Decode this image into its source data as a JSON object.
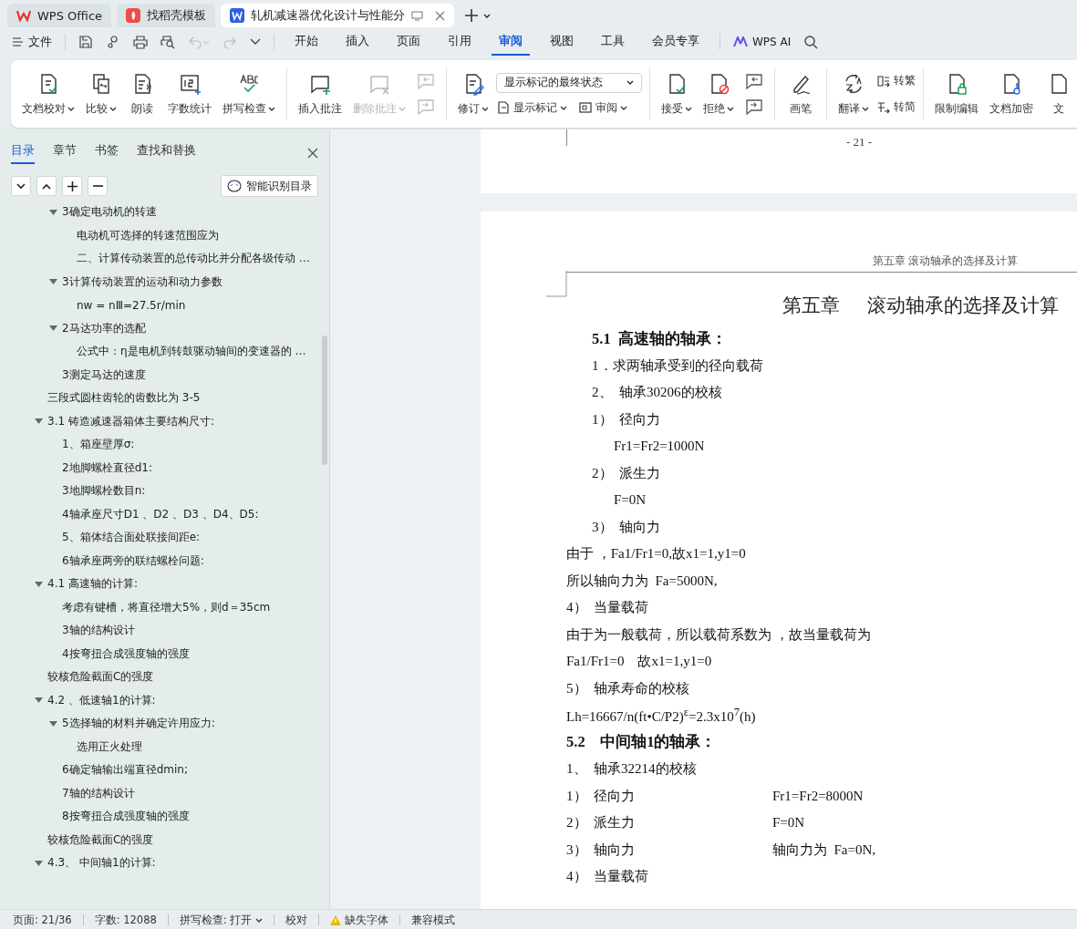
{
  "tabs": [
    {
      "label": "WPS Office",
      "kind": "home",
      "selected": false
    },
    {
      "label": "找稻壳模板",
      "kind": "template",
      "selected": false
    },
    {
      "label": "轧机减速器优化设计与性能分",
      "kind": "document",
      "selected": true
    }
  ],
  "file_menu": "文件",
  "history": {
    "undo_enabled": false,
    "redo_enabled": false
  },
  "menu_tabs": [
    {
      "label": "开始",
      "selected": false
    },
    {
      "label": "插入",
      "selected": false
    },
    {
      "label": "页面",
      "selected": false
    },
    {
      "label": "引用",
      "selected": false
    },
    {
      "label": "审阅",
      "selected": true
    },
    {
      "label": "视图",
      "selected": false
    },
    {
      "label": "工具",
      "selected": false
    },
    {
      "label": "会员专享",
      "selected": false
    }
  ],
  "ai_button": "WPS AI",
  "ribbon": {
    "groups": [
      {
        "items": [
          {
            "kind": "large",
            "label": "文档校对",
            "caret": true,
            "disabled": false
          },
          {
            "kind": "large",
            "label": "比较",
            "caret": true,
            "disabled": false
          },
          {
            "kind": "large",
            "label": "朗读",
            "caret": false,
            "disabled": false
          },
          {
            "kind": "large",
            "label": "字数统计",
            "caret": false,
            "disabled": false
          },
          {
            "kind": "large",
            "label": "拼写检查",
            "caret": true,
            "disabled": false
          }
        ]
      },
      {
        "items": [
          {
            "kind": "large",
            "label": "插入批注",
            "caret": false,
            "disabled": false
          },
          {
            "kind": "large",
            "label": "删除批注",
            "caret": true,
            "disabled": true
          },
          {
            "kind": "icon_stack",
            "disabled": true
          }
        ]
      },
      {
        "items": [
          {
            "kind": "large",
            "label": "修订",
            "caret": true,
            "disabled": false
          },
          {
            "kind": "select_panel",
            "value": "显示标记的最终状态",
            "buttons": [
              {
                "label": "显示标记",
                "caret": true
              },
              {
                "label": "审阅",
                "caret": true
              }
            ]
          }
        ]
      },
      {
        "items": [
          {
            "kind": "large",
            "label": "接受",
            "caret": true,
            "disabled": false
          },
          {
            "kind": "large",
            "label": "拒绝",
            "caret": true,
            "disabled": false
          },
          {
            "kind": "icon_stack",
            "disabled": false
          }
        ]
      },
      {
        "items": [
          {
            "kind": "large",
            "label": "画笔",
            "caret": false,
            "disabled": false
          }
        ]
      },
      {
        "items": [
          {
            "kind": "large",
            "label": "翻译",
            "caret": true,
            "disabled": false
          },
          {
            "kind": "small_stack",
            "buttons": [
              {
                "label": "转繁",
                "caret": false
              },
              {
                "label": "转简",
                "caret": false
              }
            ]
          }
        ]
      },
      {
        "items": [
          {
            "kind": "large",
            "label": "限制编辑",
            "caret": false,
            "disabled": false
          },
          {
            "kind": "large",
            "label": "文档加密",
            "caret": false,
            "disabled": false
          },
          {
            "kind": "large",
            "label": "文",
            "caret": false,
            "disabled": false
          }
        ]
      }
    ]
  },
  "nav": {
    "tabs": [
      {
        "label": "目录",
        "selected": true
      },
      {
        "label": "章节",
        "selected": false
      },
      {
        "label": "书签",
        "selected": false
      },
      {
        "label": "查找和替换",
        "selected": false
      }
    ],
    "smart_toc_button": "智能识别目录",
    "toc": {
      "continued": [
        {
          "label": "3确定电动机的转速",
          "expanded": true,
          "children": [
            {
              "label": "电动机可选择的转速范围应为"
            },
            {
              "label": "二、计算传动装置的总传动比并分配各级传动 …"
            }
          ]
        },
        {
          "label": "3计算传动装置的运动和动力参数",
          "expanded": true,
          "children": [
            {
              "label": "nw = nⅢ=27.5r/min"
            }
          ]
        },
        {
          "label": "2马达功率的选配",
          "expanded": true,
          "children": [
            {
              "label": "公式中：η是电机到转鼓驱动轴间的变速器的 …"
            }
          ]
        },
        {
          "label": "3测定马达的速度"
        }
      ],
      "items": [
        {
          "label": "三段式圆柱齿轮的齿数比为 3-5"
        },
        {
          "label": "3.1  铸造减速器箱体主要结构尺寸:",
          "expanded": true,
          "children": [
            {
              "label": "1、箱座壁厚σ:"
            },
            {
              "label": "2地脚螺栓直径d1:"
            },
            {
              "label": "3地脚螺栓数目n:"
            },
            {
              "label": "4轴承座尺寸D1 、D2 、D3 、D4、D5:"
            },
            {
              "label": "5、箱体结合面处联接间距e:"
            },
            {
              "label": "6轴承座两旁的联结螺栓问题:"
            }
          ]
        },
        {
          "label": "4.1  高速轴的计算:",
          "expanded": true,
          "children": [
            {
              "label": "考虑有键槽，将直径增大5%，则d＝35cm"
            },
            {
              "label": "3轴的结构设计"
            },
            {
              "label": "4按弯扭合成强度轴的强度"
            }
          ]
        },
        {
          "label": "较核危险截面C的强度"
        },
        {
          "label": "4.2 、低速轴1的计算:",
          "expanded": true,
          "children": [
            {
              "label": "5选择轴的材料并确定许用应力:",
              "expanded": true,
              "children": [
                {
                  "label": "选用正火处理"
                }
              ]
            },
            {
              "label": "6确定轴输出端直径dmin;"
            },
            {
              "label": "7轴的结构设计"
            },
            {
              "label": "8按弯扭合成强度轴的强度"
            }
          ]
        },
        {
          "label": "较核危险截面C的强度"
        },
        {
          "label": "4.3、 中间轴1的计算:",
          "expanded": true
        }
      ]
    }
  },
  "document": {
    "previous_page_number": "- 21 -",
    "page": {
      "running_header": "第五章  滚动轴承的选择及计算",
      "chapter_number": "第五章",
      "chapter_title": "滚动轴承的选择及计算",
      "paragraphs": [
        {
          "kind": "heading_indented",
          "text": "5.1  高速轴的轴承："
        },
        {
          "kind": "item",
          "text": "1．求两轴承受到的径向载荷"
        },
        {
          "kind": "item",
          "text": "2、  轴承30206的校核"
        },
        {
          "kind": "item",
          "text": "1）  径向力"
        },
        {
          "kind": "detail",
          "text": "Fr1=Fr2=1000N"
        },
        {
          "kind": "item",
          "text": "2）  派生力"
        },
        {
          "kind": "detail",
          "text": "F=0N"
        },
        {
          "kind": "item",
          "text": "3）  轴向力"
        },
        {
          "kind": "body",
          "text": "由于 ，Fa1/Fr1=0,故x1=1,y1=0"
        },
        {
          "kind": "body",
          "text": "所以轴向力为  Fa=5000N,"
        },
        {
          "kind": "body",
          "text": "4）  当量载荷"
        },
        {
          "kind": "body",
          "text": "由于为一般载荷，所以载荷系数为 ，故当量载荷为"
        },
        {
          "kind": "body",
          "text": "Fa1/Fr1=0    故x1=1,y1=0"
        },
        {
          "kind": "body",
          "text": "5）  轴承寿命的校核"
        },
        {
          "kind": "body",
          "text": "Lh=16667/n(ft•C/P2)$^{ε}$=2.3x10$^{7}$(h)"
        },
        {
          "kind": "heading",
          "text": "5.2    中间轴1的轴承："
        },
        {
          "kind": "body",
          "text": "1、  轴承32214的校核"
        },
        {
          "kind": "body",
          "text": "1）  径向力",
          "value": "Fr1=Fr2=8000N"
        },
        {
          "kind": "body",
          "text": "2）  派生力",
          "value": "F=0N"
        },
        {
          "kind": "body",
          "text": "3）  轴向力",
          "value": "轴向力为  Fa=0N,"
        },
        {
          "kind": "body",
          "text": "4）  当量载荷"
        }
      ]
    }
  },
  "status_bar": [
    {
      "label": "页面: 21/36",
      "kind": "text"
    },
    {
      "label": "字数: 12088",
      "kind": "text"
    },
    {
      "label": "拼写检查: 打开",
      "kind": "menu"
    },
    {
      "label": "校对",
      "kind": "text"
    },
    {
      "label": "缺失字体",
      "kind": "warning"
    },
    {
      "label": "兼容模式",
      "kind": "text"
    }
  ]
}
